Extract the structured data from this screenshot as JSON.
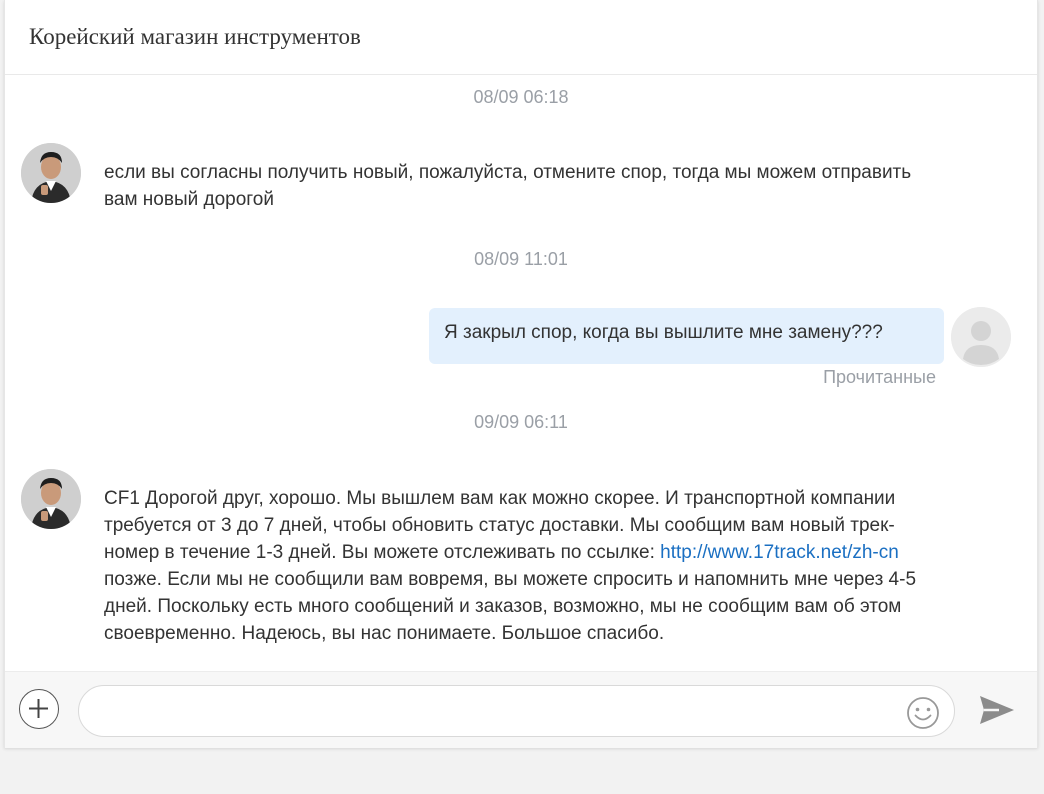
{
  "header": {
    "title": "Корейский магазин инструментов"
  },
  "conversation": {
    "messages": [
      {
        "timestamp": "08/09 06:18",
        "sender": "seller",
        "text": "если вы согласны получить новый, пожалуйста, отмените спор, тогда мы можем отправить вам новый дорогой"
      },
      {
        "timestamp": "08/09 11:01",
        "sender": "buyer",
        "text": "Я закрыл спор, когда вы вышлите мне замену???",
        "status": "Прочитанные"
      },
      {
        "timestamp": "09/09 06:11",
        "sender": "seller",
        "text_before_link": "CF1 Дорогой друг, хорошо. Мы вышлем вам как можно скорее. И транспортной компании требуется от 3 до 7 дней, чтобы обновить статус доставки. Мы сообщим вам новый трек-номер в течение 1-3 дней. Вы можете отслеживать по ссылке: ",
        "link": "http://www.17track.net/zh-cn",
        "text_after_link": " позже. Если мы не сообщили вам вовремя, вы можете спросить и напомнить мне через 4-5 дней. Поскольку есть много сообщений и заказов, возможно, мы не сообщим вам об этом своевременно. Надеюсь, вы нас понимаете. Большое спасибо."
      }
    ]
  },
  "composer": {
    "input_value": "",
    "input_placeholder": "",
    "plus_icon": "plus-circle-icon",
    "emoji_icon": "smiley-icon",
    "send_icon": "send-arrow-icon"
  },
  "colors": {
    "buyer_bubble": "#e3f0fd",
    "timestamp": "#9a9fa6",
    "link": "#1a6fc2",
    "background": "#f2f2f2"
  }
}
